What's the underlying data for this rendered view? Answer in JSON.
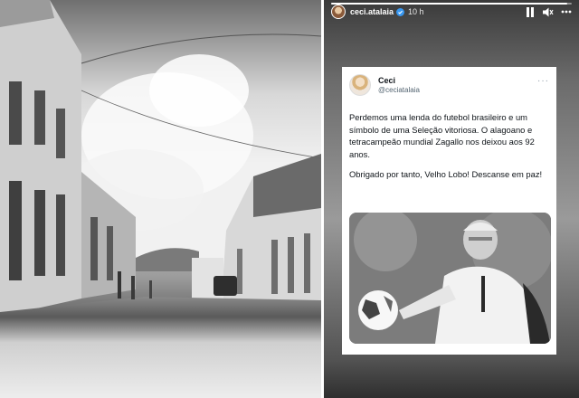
{
  "story": {
    "username": "ceci.atalaia",
    "time": "10 h",
    "progress": 0.98,
    "controls": [
      "pause-icon",
      "volume-icon",
      "more-icon"
    ]
  },
  "tweet": {
    "name": "Ceci",
    "handle": "@ceciatalaia",
    "paragraph1": "Perdemos uma lenda do futebol brasileiro e um símbolo de uma Seleção vitoriosa. O alagoano e tetracampeão mundial Zagallo nos deixou aos 92 anos.",
    "paragraph2": "Obrigado por tanto, Velho Lobo! Descanse em paz!",
    "more": "···"
  },
  "colors": {
    "tweet_text": "#0f1419",
    "tweet_handle": "#536471",
    "verified": "#1d9bf0"
  }
}
